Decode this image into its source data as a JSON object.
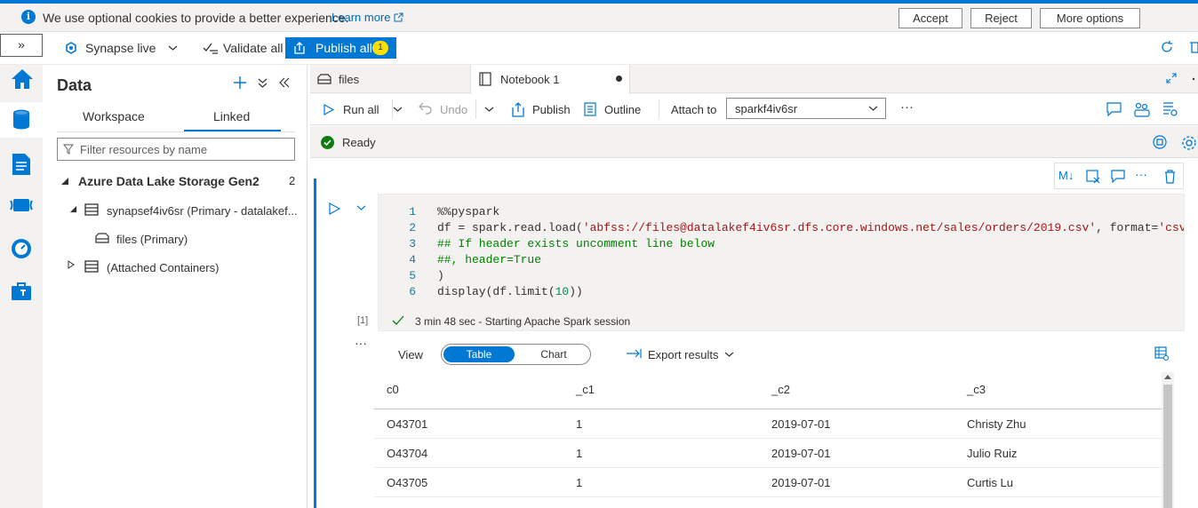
{
  "colors": {
    "accent": "#0078d4",
    "badge": "#fce100",
    "success": "#107c10",
    "link": "#0067b8"
  },
  "cookie_banner": {
    "message": "We use optional cookies to provide a better experience.",
    "learn_more": "Learn more",
    "accept": "Accept",
    "reject": "Reject",
    "more_options": "More options"
  },
  "toolbar": {
    "expand_glyph": "»",
    "mode": "Synapse live",
    "validate_all": "Validate all",
    "publish_all": "Publish all",
    "publish_count": "1"
  },
  "rail": {
    "icons": [
      "home-icon",
      "data-icon",
      "develop-icon",
      "integrate-icon",
      "monitor-icon",
      "manage-icon"
    ]
  },
  "data_pane": {
    "title": "Data",
    "tabs": [
      {
        "label": "Workspace",
        "active": false
      },
      {
        "label": "Linked",
        "active": true
      }
    ],
    "filter_placeholder": "Filter resources by name",
    "section": {
      "label": "Azure Data Lake Storage Gen2",
      "count": "2"
    },
    "tree": [
      {
        "label": "synapsef4iv6sr (Primary - datalakef..."
      },
      {
        "label": "files (Primary)"
      },
      {
        "label": "(Attached Containers)"
      }
    ]
  },
  "editor": {
    "tabs": [
      {
        "label": "files",
        "active": false
      },
      {
        "label": "Notebook 1",
        "active": true,
        "modified": true
      }
    ],
    "commands": {
      "run_all": "Run all",
      "undo": "Undo",
      "publish": "Publish",
      "outline": "Outline",
      "attach_to_label": "Attach to",
      "attach_to_value": "sparkf4iv6sr",
      "more": "···"
    },
    "status": "Ready",
    "cell_toolbar": {
      "markdown": "M↓",
      "more": "···"
    },
    "cell": {
      "lines": [
        {
          "n": "1",
          "parts": [
            {
              "t": "%%pyspark",
              "c": "plain"
            }
          ]
        },
        {
          "n": "2",
          "parts": [
            {
              "t": "df = spark.read.load(",
              "c": "plain"
            },
            {
              "t": "'abfss://files@datalakef4iv6sr.dfs.core.windows.net/sales/orders/2019.csv'",
              "c": "str"
            },
            {
              "t": ", format=",
              "c": "plain"
            },
            {
              "t": "'csv'",
              "c": "str"
            }
          ]
        },
        {
          "n": "3",
          "parts": [
            {
              "t": "## If header exists uncomment line below",
              "c": "comment"
            }
          ]
        },
        {
          "n": "4",
          "parts": [
            {
              "t": "##, header=True",
              "c": "comment"
            }
          ]
        },
        {
          "n": "5",
          "parts": [
            {
              "t": ")",
              "c": "plain"
            }
          ]
        },
        {
          "n": "6",
          "parts": [
            {
              "t": "display(df.limit(",
              "c": "plain"
            },
            {
              "t": "10",
              "c": "num"
            },
            {
              "t": "))",
              "c": "plain"
            }
          ]
        }
      ],
      "exec_count": "[1]",
      "exec_status": "3 min 48 sec - Starting Apache Spark session"
    },
    "results": {
      "view_label": "View",
      "view_options": [
        {
          "label": "Table",
          "active": true
        },
        {
          "label": "Chart",
          "active": false
        }
      ],
      "export": "Export results",
      "more": "···",
      "columns": [
        "c0",
        "_c1",
        "_c2",
        "_c3"
      ],
      "rows": [
        [
          "O43701",
          "1",
          "2019-07-01",
          "Christy Zhu"
        ],
        [
          "O43704",
          "1",
          "2019-07-01",
          "Julio Ruiz"
        ],
        [
          "O43705",
          "1",
          "2019-07-01",
          "Curtis Lu"
        ]
      ]
    }
  }
}
